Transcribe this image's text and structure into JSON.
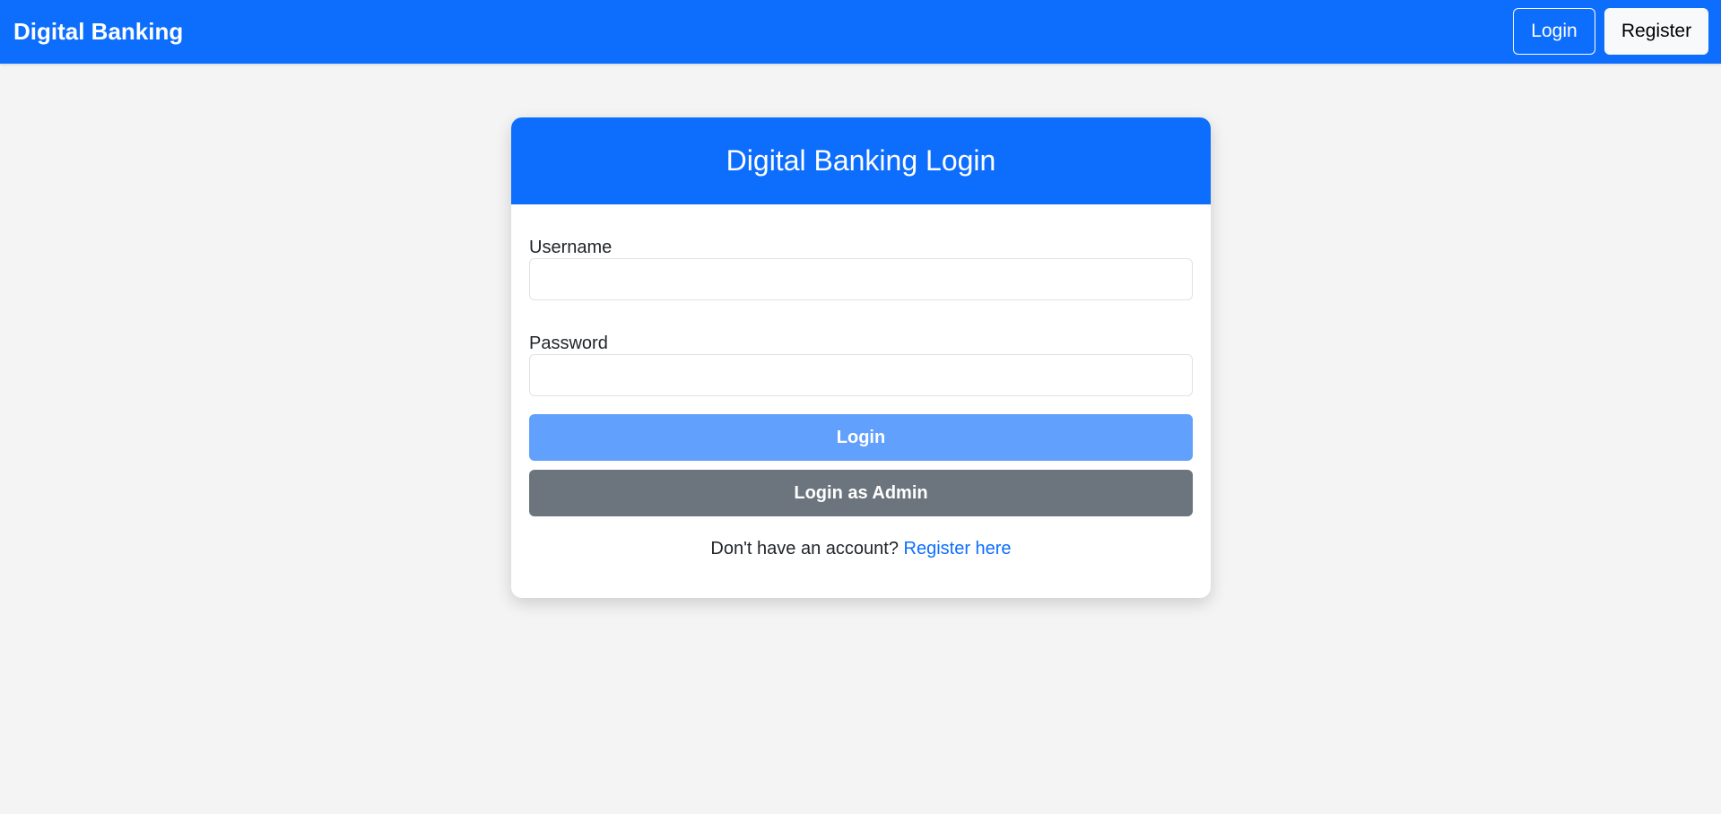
{
  "navbar": {
    "brand": "Digital Banking",
    "login_label": "Login",
    "register_label": "Register"
  },
  "login_card": {
    "title": "Digital Banking Login",
    "username_label": "Username",
    "username_value": "",
    "password_label": "Password",
    "password_value": "",
    "login_button": "Login",
    "admin_button": "Login as Admin",
    "register_prompt": "Don't have an account? ",
    "register_link": "Register here"
  },
  "colors": {
    "primary": "#0d6efd",
    "login_button_bg": "#62a0fd",
    "admin_button_bg": "#6c757d",
    "page_bg": "#f4f4f4"
  }
}
